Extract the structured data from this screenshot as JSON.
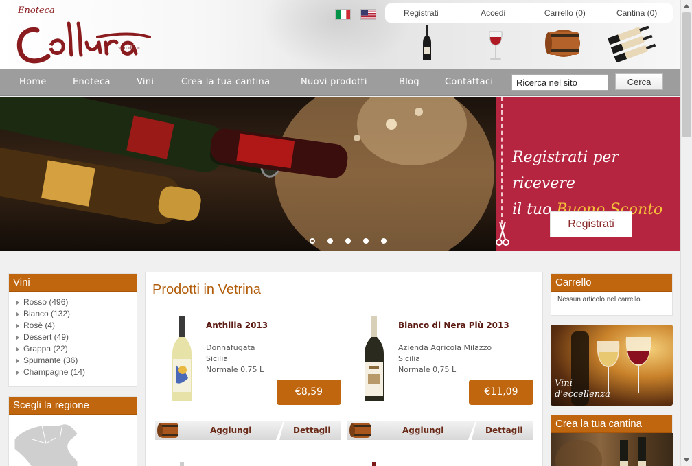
{
  "brand": {
    "prefix": "Enoteca",
    "name": "Collura",
    "tagline": "vini d.o.c.",
    "accent": "#c0660f",
    "wine_red": "#8a1c1f"
  },
  "languages": [
    {
      "name": "italian-flag-icon",
      "label": "Italiano"
    },
    {
      "name": "us-flag-icon",
      "label": "English"
    }
  ],
  "topbar": {
    "register": "Registrati",
    "login": "Accedi",
    "cart": "Carrello (0)",
    "cellar": "Cantina (0)"
  },
  "nav": {
    "items": [
      "Home",
      "Enoteca",
      "Vini",
      "Crea la tua cantina",
      "Nuovi prodotti",
      "Blog",
      "Contattaci"
    ],
    "search_placeholder": "Ricerca nel sito",
    "search_value": "Ricerca nel sito",
    "search_button": "Cerca"
  },
  "banner": {
    "promo_line1": "Registrati per ricevere",
    "promo_line2_prefix": "il tuo",
    "promo_line2_highlight": "Buono Sconto",
    "promo_button": "Registrati",
    "promo_color": "#b5253f",
    "slide_count": 5,
    "active_slide": 1
  },
  "sidebar": {
    "vini": {
      "title": "Vini",
      "items": [
        {
          "label": "Rosso (496)"
        },
        {
          "label": "Bianco (132)"
        },
        {
          "label": "Rosè (4)"
        },
        {
          "label": "Dessert (49)"
        },
        {
          "label": "Grappa (22)"
        },
        {
          "label": "Spumante (36)"
        },
        {
          "label": "Champagne (14)"
        }
      ]
    },
    "regione": {
      "title": "Scegli la regione"
    }
  },
  "main": {
    "title": "Prodotti in Vetrina",
    "products": [
      {
        "name": "Anthilia 2013",
        "producer": "Donnafugata",
        "region": "Sicilia",
        "format": "Normale 0,75 L",
        "price": "€8,59",
        "add": "Aggiungi",
        "details": "Dettagli"
      },
      {
        "name": "Bianco di Nera Più 2013",
        "producer": "Azienda Agricola Milazzo",
        "region": "Sicilia",
        "format": "Normale 0,75 L",
        "price": "€11,09",
        "add": "Aggiungi",
        "details": "Dettagli"
      }
    ]
  },
  "right": {
    "cart_title": "Carrello",
    "cart_empty": "Nessun articolo nel carrello.",
    "promo_line1": "Vini",
    "promo_line2": "d'eccellenza",
    "cantina_title": "Crea la tua cantina"
  }
}
